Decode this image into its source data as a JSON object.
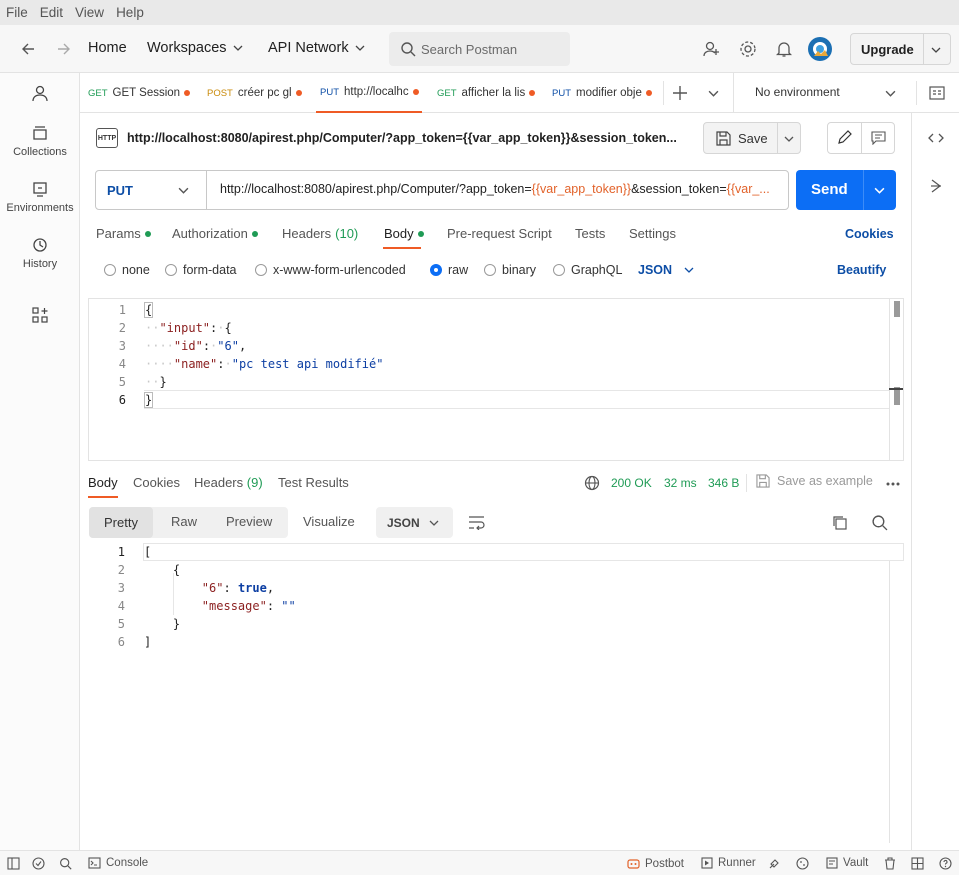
{
  "menubar": [
    "File",
    "Edit",
    "View",
    "Help"
  ],
  "header": {
    "home": "Home",
    "workspaces": "Workspaces",
    "api_network": "API Network",
    "search_placeholder": "Search Postman",
    "upgrade": "Upgrade"
  },
  "sidebar": {
    "items": [
      {
        "label": "Collections",
        "icon": "collections-icon"
      },
      {
        "label": "Environments",
        "icon": "environments-icon"
      },
      {
        "label": "History",
        "icon": "history-icon"
      }
    ]
  },
  "tabs": [
    {
      "method": "GET",
      "title": "GET Session",
      "method_color": "#1f9b55"
    },
    {
      "method": "POST",
      "title": "créer pc gl",
      "method_color": "#c98a0a"
    },
    {
      "method": "PUT",
      "title": "http://localhc",
      "method_color": "#0d4ea6"
    },
    {
      "method": "GET",
      "title": "afficher la lis",
      "method_color": "#1f9b55"
    },
    {
      "method": "PUT",
      "title": "modifier obje",
      "method_color": "#0d4ea6"
    }
  ],
  "environment": "No environment",
  "request": {
    "title": "http://localhost:8080/apirest.php/Computer/?app_token={{var_app_token}}&session_token...",
    "badge": "HTTP",
    "save": "Save",
    "method": "PUT",
    "url_prefix": "http://localhost:8080/apirest.php/Computer/?app_token=",
    "url_var1": "{{var_app_token}}",
    "url_mid": "&session_token=",
    "url_var2": "{{var_...",
    "send": "Send"
  },
  "subtabs": {
    "params": "Params",
    "authorization": "Authorization",
    "headers": "Headers",
    "headers_count": "(10)",
    "body": "Body",
    "prerequest": "Pre-request Script",
    "tests": "Tests",
    "settings": "Settings",
    "cookies": "Cookies"
  },
  "body_types": {
    "none": "none",
    "form_data": "form-data",
    "urlencoded": "x-www-form-urlencoded",
    "raw": "raw",
    "binary": "binary",
    "graphql": "GraphQL",
    "format": "JSON",
    "beautify": "Beautify"
  },
  "request_body": {
    "line_numbers": [
      "1",
      "2",
      "3",
      "4",
      "5",
      "6"
    ],
    "open": "{",
    "input_key": "\"input\"",
    "id_key": "\"id\"",
    "id_val": "\"6\"",
    "name_key": "\"name\"",
    "name_val": "\"pc test api modifié\"",
    "close_inner": "}",
    "close": "}"
  },
  "response": {
    "tabs": {
      "body": "Body",
      "cookies": "Cookies",
      "headers": "Headers",
      "headers_count": "(9)",
      "test_results": "Test Results"
    },
    "status": "200 OK",
    "time": "32 ms",
    "size": "346 B",
    "save_example": "Save as example",
    "views": {
      "pretty": "Pretty",
      "raw": "Raw",
      "preview": "Preview",
      "visualize": "Visualize"
    },
    "format": "JSON",
    "line_numbers": [
      "1",
      "2",
      "3",
      "4",
      "5",
      "6"
    ],
    "l1": "[",
    "l2": "{",
    "k6": "\"6\"",
    "v6": "true",
    "kmsg": "\"message\"",
    "vmsg": "\"\"",
    "l5": "}",
    "l6": "]"
  },
  "statusbar": {
    "console": "Console",
    "postbot": "Postbot",
    "runner": "Runner",
    "vault": "Vault"
  },
  "colors": {
    "accent": "#ef5b25",
    "primary": "#0c6ef5",
    "success": "#1f9b55"
  }
}
